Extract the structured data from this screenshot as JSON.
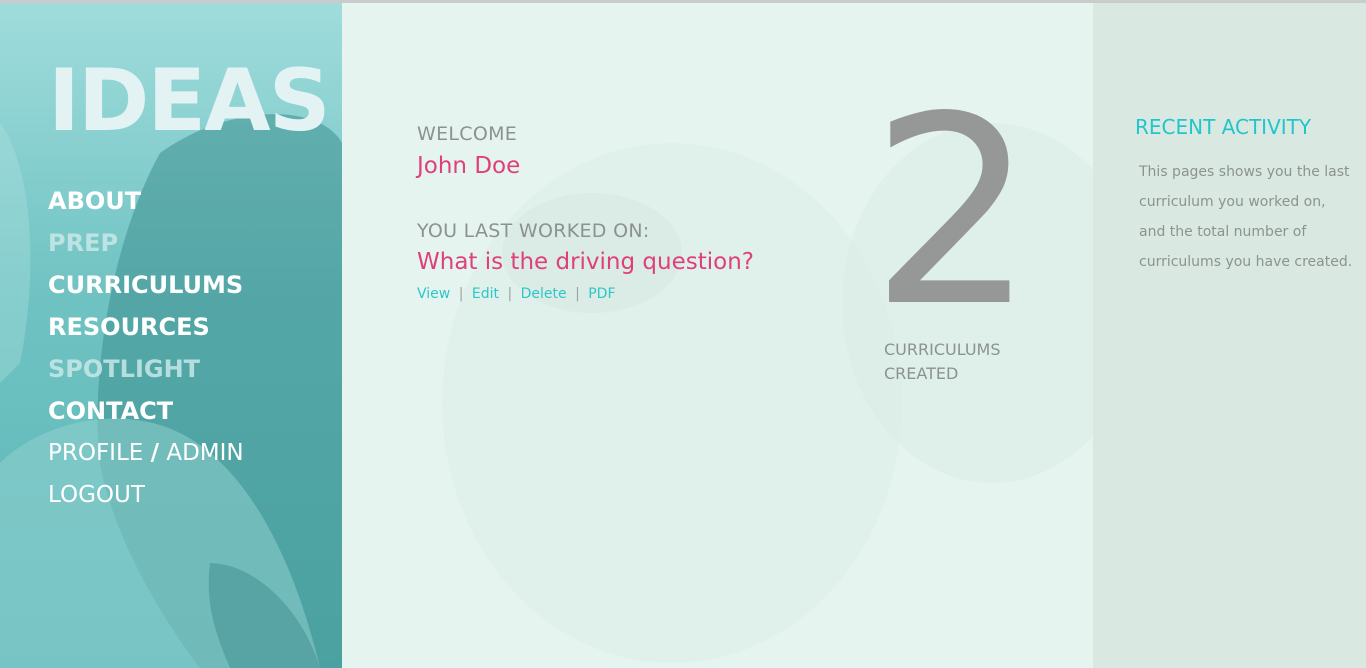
{
  "brand": {
    "logo": "IDEAS"
  },
  "nav": {
    "about": "ABOUT",
    "prep": "PREP",
    "curriculums": "CURRICULUMS",
    "resources": "RESOURCES",
    "spotlight": "SPOTLIGHT",
    "contact": "CONTACT",
    "profile": "PROFILE",
    "slash": "/",
    "admin": "ADMIN",
    "logout": "LOGOUT"
  },
  "main": {
    "welcome_label": "WELCOME",
    "user_name": "John Doe",
    "last_worked_label": "YOU LAST WORKED ON:",
    "last_worked_title": "What is the driving question?",
    "actions": {
      "view": "View",
      "edit": "Edit",
      "delete": "Delete",
      "pdf": "PDF",
      "separator": "|"
    },
    "count": "2",
    "count_label_line1": "CURRICULUMS",
    "count_label_line2": "CREATED"
  },
  "recent": {
    "title": "RECENT ACTIVITY",
    "description": "This pages shows you the last curriculum you worked on, and the total number of curriculums you have created."
  },
  "colors": {
    "accent_pink": "#e0407a",
    "accent_teal": "#2ec6c9",
    "sidebar_teal": "#6fc2c2",
    "main_bg": "#e5f4ef",
    "recent_bg": "#d9e9e2",
    "muted_text": "#8c9290"
  }
}
